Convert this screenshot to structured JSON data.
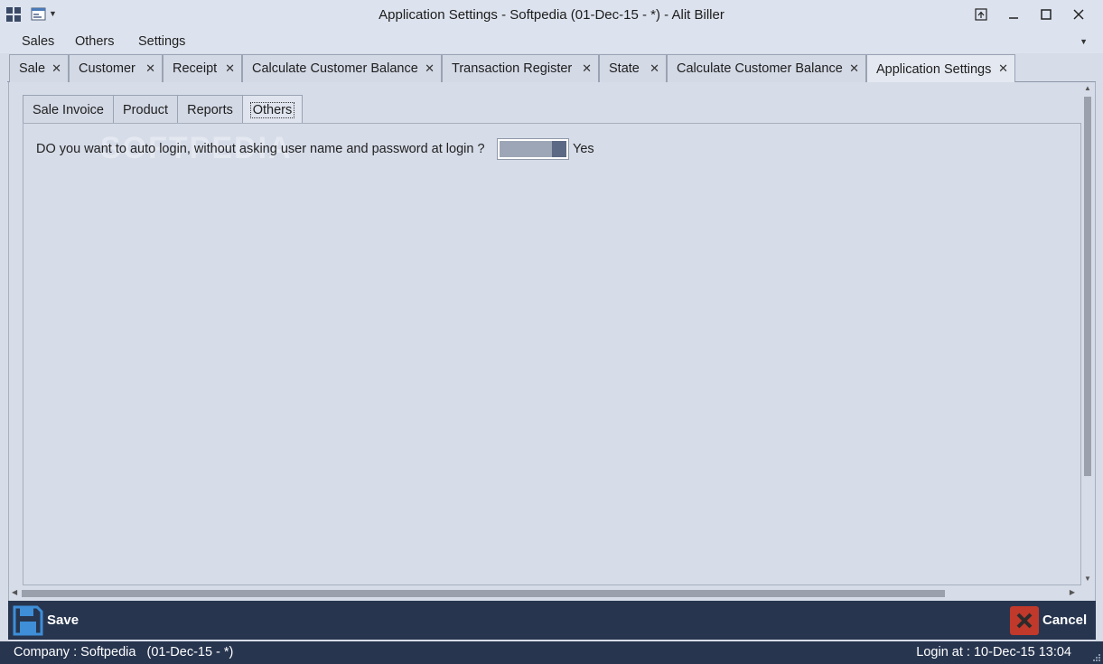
{
  "window": {
    "title": "Application Settings - Softpedia (01-Dec-15 - *) - Alit Biller",
    "app_icon": "app-grid-icon",
    "quick_access_icon": "quick-access-icon",
    "controls": {
      "restore_ribbon": "restore-ribbon-icon",
      "minimize": "minimize-icon",
      "maximize": "maximize-icon",
      "close": "close-icon"
    }
  },
  "menu": {
    "items": [
      "Sales",
      "Others",
      "Settings"
    ]
  },
  "doc_tabs": [
    {
      "label": "Sale"
    },
    {
      "label": "Customer"
    },
    {
      "label": "Receipt"
    },
    {
      "label": "Calculate Customer Balance"
    },
    {
      "label": "Transaction Register"
    },
    {
      "label": "State"
    },
    {
      "label": "Calculate Customer Balance"
    },
    {
      "label": "Application Settings"
    }
  ],
  "inner_tabs": [
    {
      "label": "Sale Invoice"
    },
    {
      "label": "Product"
    },
    {
      "label": "Reports"
    },
    {
      "label": "Others"
    }
  ],
  "others_panel": {
    "question": "DO you want to auto login, without asking user name and password at login ?",
    "toggle_state": "on",
    "toggle_label": "Yes"
  },
  "watermark": "SOFTPEDIA",
  "actions": {
    "save_label": "Save",
    "cancel_label": "Cancel"
  },
  "status": {
    "company": "Company : Softpedia   (01-Dec-15 - *)",
    "login": "Login at : 10-Dec-15 13:04"
  },
  "colors": {
    "background": "#d6dce8",
    "action_bar": "#27354f",
    "save_icon": "#3e8ed8",
    "cancel_icon": "#c0392b"
  }
}
